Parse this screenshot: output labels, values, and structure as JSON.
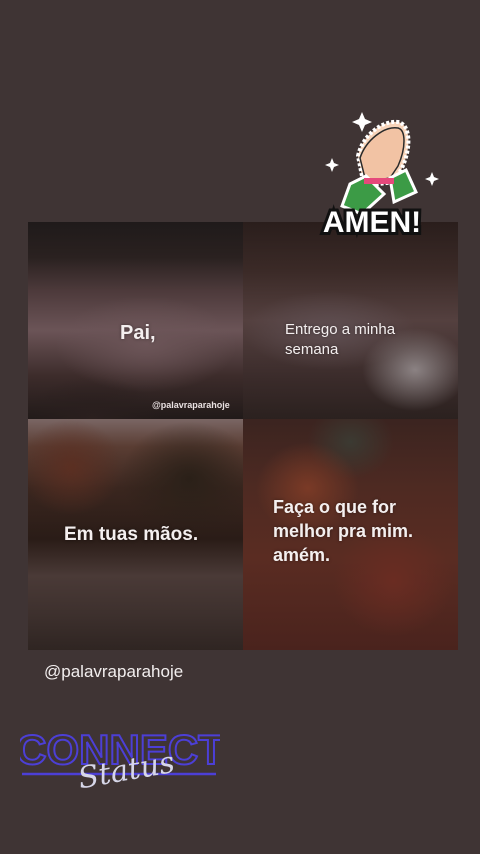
{
  "captions": {
    "top_left": "Pai,",
    "top_right_line1": "Entrego a minha",
    "top_right_line2": "semana",
    "bottom_left": "Em tuas mãos.",
    "bottom_right_line1": "Faça o que for",
    "bottom_right_line2": "melhor pra mim.",
    "bottom_right_line3": "amém."
  },
  "watermark": "@palavraparahoje",
  "handle": "@palavraparahoje",
  "stickers": {
    "amen_text": "AMEN!",
    "connect_text": "CONNECT",
    "status_text": "Status"
  }
}
